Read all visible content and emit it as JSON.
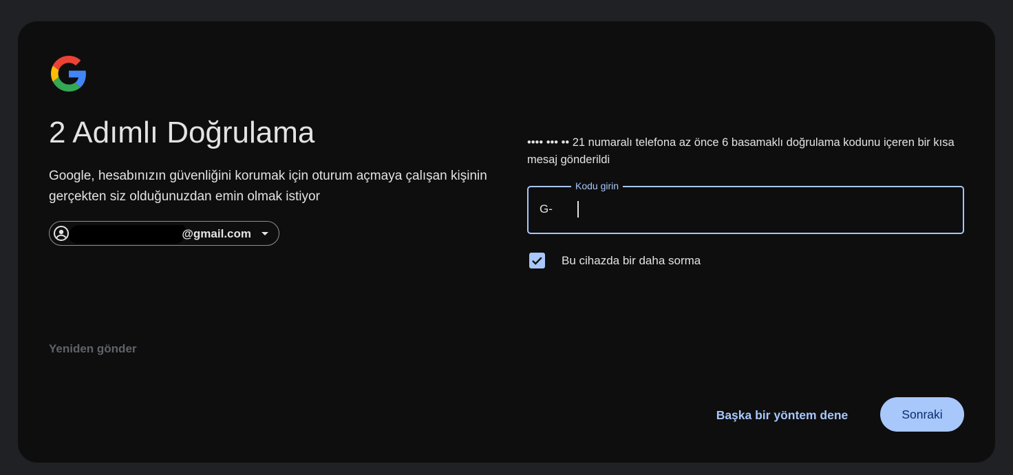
{
  "header": {
    "logo_icon": "google-g-logo",
    "title": "2 Adımlı Doğrulama",
    "subtitle": "Google, hesabınızın güvenliğini korumak için oturum açmaya çalışan kişinin gerçekten siz olduğunuzdan emin olmak istiyor"
  },
  "account": {
    "avatar_icon": "account-circle-icon",
    "email_visible": "@gmail.com",
    "caret_icon": "caret-down-icon"
  },
  "resend": {
    "label": "Yeniden gönder"
  },
  "verification": {
    "info_text": "•••• ••• •• 21 numaralı telefona az önce 6 basamaklı doğrulama kodunu içeren bir kısa mesaj gönderildi",
    "code_label": "Kodu girin",
    "code_prefix": "G-",
    "code_value": ""
  },
  "remember_device": {
    "label": "Bu cihazda bir daha sorma",
    "checked": true
  },
  "actions": {
    "try_another_label": "Başka bir yöntem dene",
    "next_label": "Sonraki"
  },
  "colors": {
    "background": "#202124",
    "card": "#0e0e0f",
    "accent": "#a8c7fa",
    "text": "#e3e3e3",
    "muted": "#5f6368"
  }
}
